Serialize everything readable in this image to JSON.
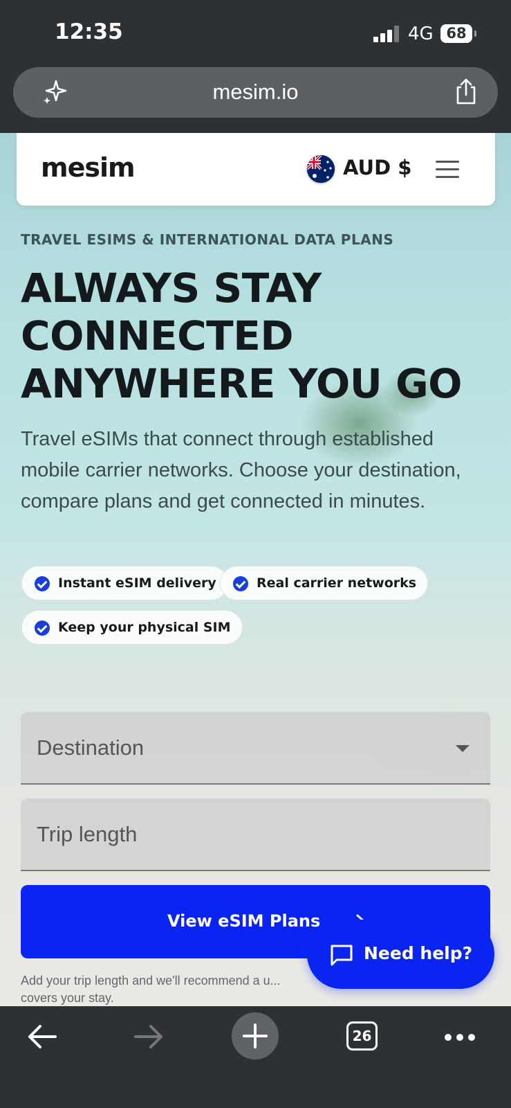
{
  "status_bar": {
    "time": "12:35",
    "network": "4G",
    "battery": "68"
  },
  "browser": {
    "url": "mesim.io",
    "tab_count": "26"
  },
  "header": {
    "logo": "mesim",
    "currency": "AUD $"
  },
  "hero": {
    "eyebrow": "TRAVEL ESIMS & INTERNATIONAL DATA PLANS",
    "headline_line1": "ALWAYS STAY",
    "headline_line2": "CONNECTED",
    "headline_line3": "ANYWHERE YOU GO",
    "description": "Travel eSIMs that connect through established mobile carrier networks. Choose your destination, compare plans and get connected in minutes."
  },
  "features": [
    "Instant eSIM delivery",
    "Real carrier networks",
    "Keep your physical SIM"
  ],
  "form": {
    "destination_label": "Destination",
    "trip_length_label": "Trip length",
    "cta_label": "View eSIM Plans",
    "helper_text": "Add your trip length and we'll recommend a u... covers your stay."
  },
  "help": {
    "label": "Need help?"
  },
  "colors": {
    "accent": "#0a24f2",
    "check": "#1a3fd8",
    "chrome": "#2e3134"
  }
}
